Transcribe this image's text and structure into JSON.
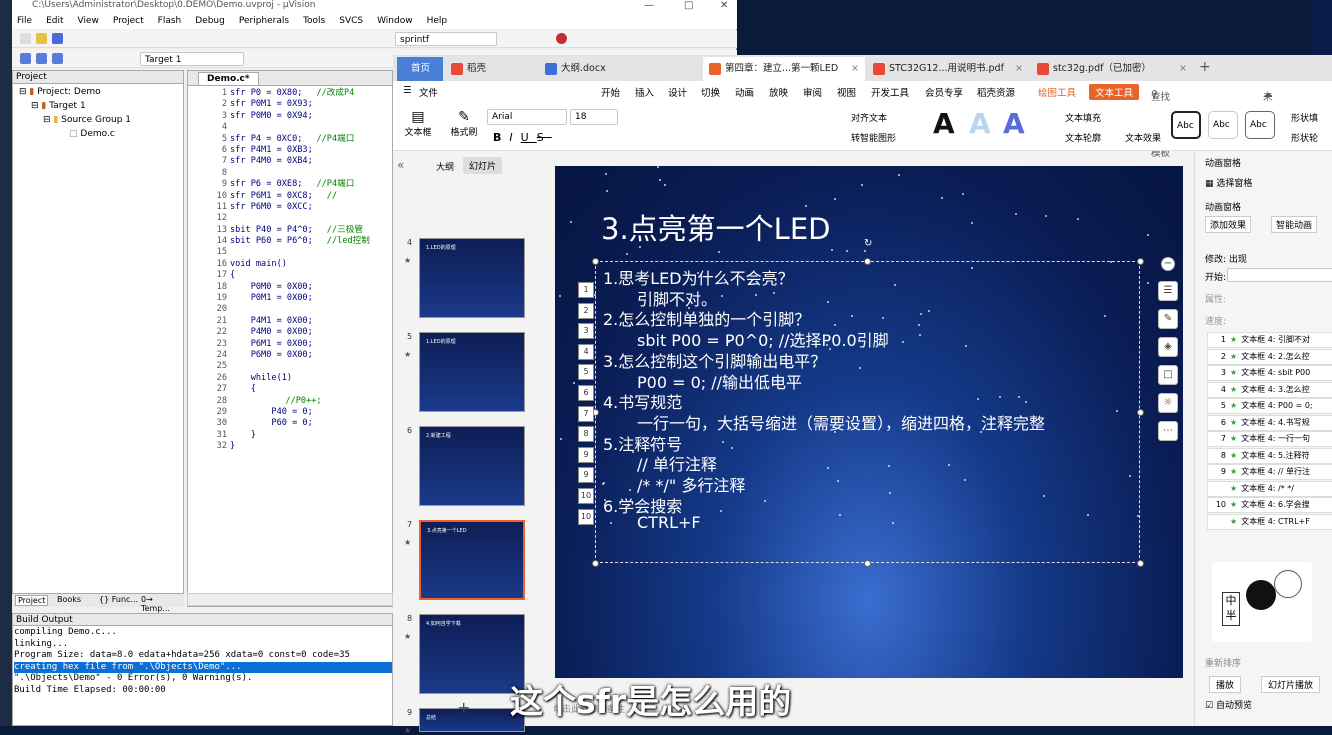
{
  "keil": {
    "title": "C:\\Users\\Administrator\\Desktop\\0.DEMO\\Demo.uvproj - µVision",
    "menu": [
      "File",
      "Edit",
      "View",
      "Project",
      "Flash",
      "Debug",
      "Peripherals",
      "Tools",
      "SVCS",
      "Window",
      "Help"
    ],
    "toolbar_search": "sprintf",
    "target": "Target 1",
    "project_title": "Project",
    "tree": [
      "Project: Demo",
      "Target 1",
      "Source Group 1",
      "Demo.c"
    ],
    "project_tabs": [
      "Project",
      "Books",
      "{} Func...",
      "0→ Temp..."
    ],
    "editor_tab": "Demo.c*",
    "code": [
      {
        "n": "1",
        "t": "sfr P0 = 0X80;",
        "c": "//改成P4"
      },
      {
        "n": "2",
        "t": "sfr P0M1 = 0X93;",
        "c": ""
      },
      {
        "n": "3",
        "t": "sfr P0M0 = 0X94;",
        "c": ""
      },
      {
        "n": "4",
        "t": "",
        "c": ""
      },
      {
        "n": "5",
        "t": "sfr P4 = 0XC0;",
        "c": "//P4端口"
      },
      {
        "n": "6",
        "t": "sfr P4M1 = 0XB3;",
        "c": ""
      },
      {
        "n": "7",
        "t": "sfr P4M0 = 0XB4;",
        "c": ""
      },
      {
        "n": "8",
        "t": "",
        "c": ""
      },
      {
        "n": "9",
        "t": "sfr P6 = 0XE8;",
        "c": "//P4端口"
      },
      {
        "n": "10",
        "t": "sfr P6M1 = 0XC8;",
        "c": "//"
      },
      {
        "n": "11",
        "t": "sfr P6M0 = 0XCC;",
        "c": ""
      },
      {
        "n": "12",
        "t": "",
        "c": ""
      },
      {
        "n": "13",
        "t": "sbit P40 = P4^0;",
        "c": "//三极管"
      },
      {
        "n": "14",
        "t": "sbit P60 = P6^0;",
        "c": "//led控制"
      },
      {
        "n": "15",
        "t": "",
        "c": ""
      },
      {
        "n": "16",
        "t": "void main()",
        "c": ""
      },
      {
        "n": "17",
        "t": "{",
        "c": ""
      },
      {
        "n": "18",
        "t": "    P0M0 = 0X00;",
        "c": ""
      },
      {
        "n": "19",
        "t": "    P0M1 = 0X00;",
        "c": ""
      },
      {
        "n": "20",
        "t": "",
        "c": ""
      },
      {
        "n": "21",
        "t": "    P4M1 = 0X00;",
        "c": ""
      },
      {
        "n": "22",
        "t": "    P4M0 = 0X00;",
        "c": ""
      },
      {
        "n": "23",
        "t": "    P6M1 = 0X00;",
        "c": ""
      },
      {
        "n": "24",
        "t": "    P6M0 = 0X00;",
        "c": ""
      },
      {
        "n": "25",
        "t": "",
        "c": ""
      },
      {
        "n": "26",
        "t": "    while(1)",
        "c": ""
      },
      {
        "n": "27",
        "t": "    {",
        "c": ""
      },
      {
        "n": "28",
        "t": "",
        "c": "        //P0++;"
      },
      {
        "n": "29",
        "t": "        P40 = 0;",
        "c": ""
      },
      {
        "n": "30",
        "t": "        P60 = 0;",
        "c": ""
      },
      {
        "n": "31",
        "t": "    }",
        "c": ""
      },
      {
        "n": "32",
        "t": "}",
        "c": ""
      }
    ],
    "build_title": "Build Output",
    "build_lines": [
      "compiling Demo.c...",
      "linking...",
      "Program Size: data=8.0 edata+hdata=256 xdata=0 const=0 code=35",
      "creating hex file from \".\\Objects\\Demo\"...",
      "\".\\Objects\\Demo\" - 0 Error(s), 0 Warning(s).",
      "Build Time Elapsed:  00:00:00"
    ]
  },
  "wps": {
    "tabs": [
      {
        "label": "首页",
        "color": "#4a7fd8"
      },
      {
        "label": "稻壳",
        "color": "#e84a3a"
      },
      {
        "label": "大纲.docx",
        "color": "#3a6fd8"
      },
      {
        "label": "第四章：建立...第一颗LED",
        "color": "#e8632a"
      },
      {
        "label": "STC32G12...用说明书.pdf",
        "color": "#e84a3a"
      },
      {
        "label": "stc32g.pdf（已加密）",
        "color": "#e84a3a"
      }
    ],
    "menu": [
      "文件",
      "开始",
      "插入",
      "设计",
      "切换",
      "动画",
      "放映",
      "审阅",
      "视图",
      "开发工具",
      "会员专享",
      "稻壳资源",
      "绘图工具",
      "文本工具"
    ],
    "search": "查找命令、搜索模板",
    "sync": "未同步",
    "font": "Arial",
    "font_size": "18",
    "ribbon": {
      "textbox": "文本框",
      "format_brush": "格式刷",
      "align_text": "对齐文本",
      "smart_shape": "转智能图形",
      "text_fill": "文本填充",
      "text_outline": "文本轮廓",
      "text_effect": "文本效果",
      "shape_fill": "形状填",
      "shape_outline": "形状轮",
      "style_abc": "Abc"
    },
    "pane_tabs": [
      "大纲",
      "幻灯片"
    ],
    "thumbs": [
      {
        "n": "4",
        "text": "1.LED的原理"
      },
      {
        "n": "5",
        "text": "1.LED的原理"
      },
      {
        "n": "6",
        "text": "2.新建工程"
      },
      {
        "n": "7",
        "text": "3.点亮第一个LED"
      },
      {
        "n": "8",
        "text": "4.如何自学下载"
      },
      {
        "n": "9",
        "text": "总结"
      }
    ],
    "slide_title": "3.点亮第一个LED",
    "slide_lines": [
      "1.思考LED为什么不会亮？",
      "引脚不对。",
      "2.怎么控制单独的一个引脚？",
      "sbit P00 = P0^0;        //选择P0.0引脚",
      "3.怎么控制这个引脚输出电平？",
      "P00 = 0;       //输出低电平",
      "4.书写规范",
      "一行一句，大括号缩进（需要设置），缩进四格，注释完整",
      "5.注释符号",
      "//  单行注释",
      "/*   */\"  多行注释",
      "6.学会搜索",
      "CTRL+F"
    ],
    "anim_markers": [
      "1",
      "2",
      "3",
      "4",
      "5",
      "6",
      "7",
      "8",
      "9",
      "9",
      "10",
      "10"
    ],
    "anim_pane": {
      "title": "动画窗格",
      "select_pane": "选择窗格",
      "anim_label": "动画窗格",
      "add_effect": "添加效果",
      "smart_anim": "智能动画",
      "modify": "修改: 出现",
      "start": "开始:",
      "property": "属性:",
      "speed": "速度:",
      "reorder": "重新排序",
      "play": "播放",
      "slideshow": "幻灯片播放",
      "autopreview": "自动预览",
      "items": [
        {
          "n": "1",
          "t": "文本框 4: 引脚不对"
        },
        {
          "n": "2",
          "t": "文本框 4: 2.怎么控"
        },
        {
          "n": "3",
          "t": "文本框 4: sbit P00"
        },
        {
          "n": "4",
          "t": "文本框 4: 3.怎么控"
        },
        {
          "n": "5",
          "t": "文本框 4: P00 = 0;"
        },
        {
          "n": "6",
          "t": "文本框 4: 4.书写规"
        },
        {
          "n": "7",
          "t": "文本框 4: 一行一句"
        },
        {
          "n": "8",
          "t": "文本框 4: 5.注释符"
        },
        {
          "n": "9",
          "t": "文本框 4: //  单行注"
        },
        {
          "n": "",
          "t": "文本框 4: /*   */"
        },
        {
          "n": "10",
          "t": "文本框 4: 6.学会搜"
        },
        {
          "n": "",
          "t": "文本框 4: CTRL+F"
        }
      ]
    },
    "notes": "单击此处添加备注"
  },
  "subtitle": "这个sfr是怎么用的",
  "mascot_text": "中半"
}
